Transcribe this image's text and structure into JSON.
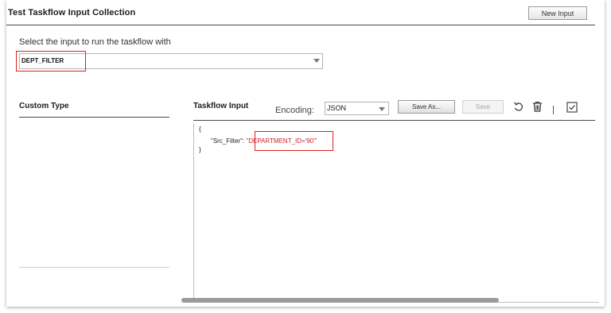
{
  "header": {
    "title": "Test Taskflow Input Collection",
    "new_input_label": "New Input"
  },
  "input_select": {
    "label": "Select the input to run the taskflow with",
    "value": "DEPT_FILTER"
  },
  "custom_type": {
    "heading": "Custom Type"
  },
  "taskflow_input": {
    "heading": "Taskflow Input",
    "encoding_label": "Encoding:",
    "encoding_value": "JSON",
    "save_as_label": "Save As...",
    "save_label": "Save",
    "icons": [
      "undo-icon",
      "trash-icon",
      "check-square-icon"
    ]
  },
  "editor": {
    "line1": "{",
    "key": "\"Src_Filter\": ",
    "value_prefix": "\"DEPARTMENT_ID='90'",
    "value_suffix": "\"",
    "line3": "}"
  },
  "colors": {
    "highlight": "#e02020",
    "json_string": "#cc2222"
  }
}
